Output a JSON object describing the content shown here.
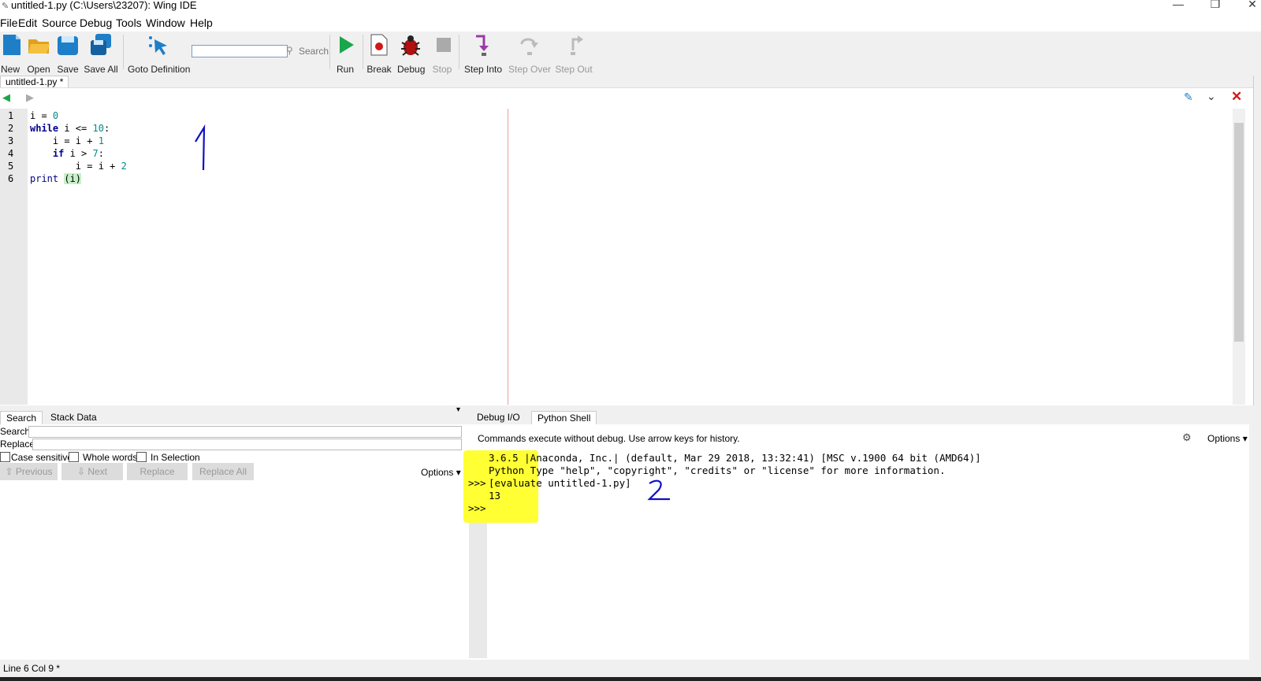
{
  "window": {
    "title": "untitled-1.py (C:\\Users\\23207): Wing IDE"
  },
  "menu": [
    "File",
    "Edit",
    "Source",
    "Debug",
    "Tools",
    "Window",
    "Help"
  ],
  "toolbar": {
    "new": "New",
    "open": "Open",
    "save": "Save",
    "save_all": "Save All",
    "goto_definition": "Goto Definition",
    "search_label": "Search",
    "search_value": "",
    "run": "Run",
    "break": "Break",
    "debug": "Debug",
    "stop": "Stop",
    "step_into": "Step Into",
    "step_over": "Step Over",
    "step_out": "Step Out"
  },
  "editor": {
    "tab": "untitled-1.py *",
    "line_numbers": [
      "1",
      "2",
      "3",
      "4",
      "5",
      "6"
    ],
    "annotation": "1"
  },
  "search_panel": {
    "tabs": [
      "Search",
      "Stack Data"
    ],
    "search_label": "Search:",
    "replace_label": "Replace:",
    "case_sensitive": "Case sensitive",
    "whole_words": "Whole words",
    "in_selection": "In Selection",
    "previous": "Previous",
    "next": "Next",
    "replace": "Replace",
    "replace_all": "Replace All",
    "options": "Options"
  },
  "shell_panel": {
    "tabs": [
      "Debug I/O",
      "Python Shell"
    ],
    "info": "Commands execute without debug.  Use arrow keys for history.",
    "options": "Options",
    "lines": [
      "3.6.5 |Anaconda, Inc.| (default, Mar 29 2018, 13:32:41) [MSC v.1900 64 bit (AMD64)]",
      "Python Type \"help\", \"copyright\", \"credits\" or \"license\" for more information.",
      "[evaluate untitled-1.py]",
      "13"
    ],
    "prompts": [
      ">>>",
      ">>>"
    ],
    "annotation": "2"
  },
  "status": "Line 6 Col 9 *"
}
